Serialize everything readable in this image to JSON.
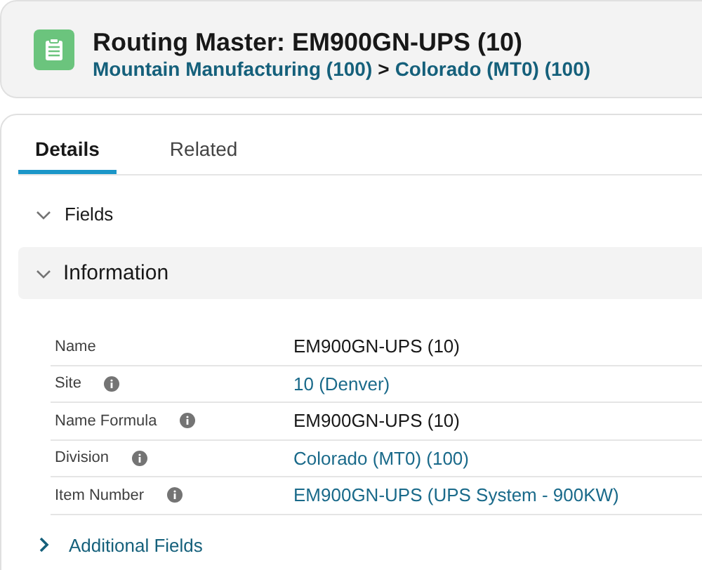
{
  "header": {
    "title": "Routing Master: EM900GN-UPS (10)",
    "breadcrumb": [
      {
        "label": "Mountain Manufacturing (100)"
      },
      {
        "label": "Colorado (MT0) (100)"
      }
    ],
    "separator": ">"
  },
  "tabs": [
    {
      "label": "Details",
      "selected": true
    },
    {
      "label": "Related",
      "selected": false
    }
  ],
  "fields_section": {
    "label": "Fields",
    "expanded": true
  },
  "information_section": {
    "label": "Information",
    "expanded": true
  },
  "rows": [
    {
      "label": "Name",
      "info": false,
      "value": "EM900GN-UPS (10)",
      "link": false
    },
    {
      "label": "Site",
      "info": true,
      "value": "10 (Denver)",
      "link": true
    },
    {
      "label": "Name Formula",
      "info": true,
      "value": "EM900GN-UPS (10)",
      "link": false
    },
    {
      "label": "Division",
      "info": true,
      "value": "Colorado (MT0) (100)",
      "link": true
    },
    {
      "label": "Item Number",
      "info": true,
      "value": "EM900GN-UPS (UPS System - 900KW)",
      "link": true
    }
  ],
  "additional_section": {
    "label": "Additional Fields",
    "expanded": false
  }
}
